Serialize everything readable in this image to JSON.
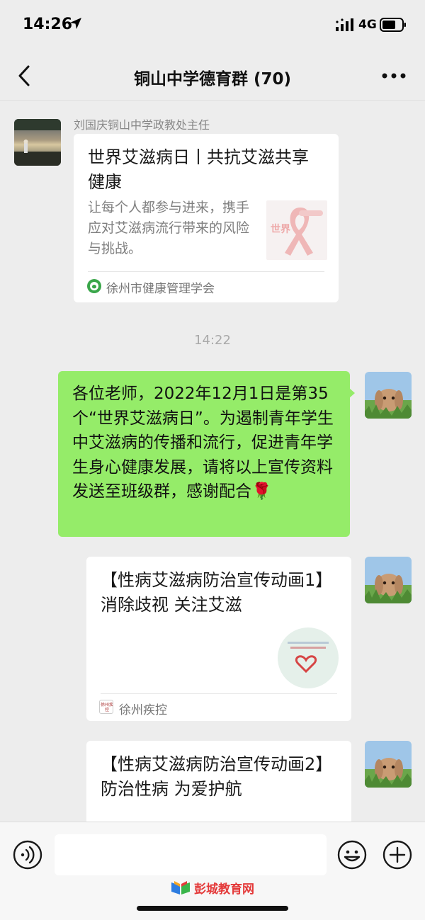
{
  "status_bar": {
    "time": "14:26",
    "network": "4G"
  },
  "header": {
    "title": "铜山中学德育群 (70)"
  },
  "messages": {
    "sender_name": "刘国庆铜山中学政教处主任",
    "card1": {
      "title": "世界艾滋病日丨共抗艾滋共享健康",
      "description": "让每个人都参与进来，携手应对艾滋病流行带来的风险与挑战。",
      "source": "徐州市健康管理学会",
      "thumb_text": "世界"
    },
    "timestamp": "14:22",
    "text_message": "各位老师，2022年12月1日是第35个“世界艾滋病日”。为遏制青年学生中艾滋病的传播和流行，促进青年学生身心健康发展，请将以上宣传资料发送至班级群，感谢配合🌹",
    "card2": {
      "title": "【性病艾滋病防治宣传动画1】消除歧视 关注艾滋",
      "source": "徐州疾控",
      "source_logo_text": "徐州疾控"
    },
    "card3": {
      "title": "【性病艾滋病防治宣传动画2】防治性病 为爱护航"
    }
  },
  "input_bar": {
    "placeholder": ""
  },
  "watermark": {
    "text": "彭城教育网"
  },
  "colors": {
    "bubble_green": "#95ec69",
    "background": "#ededed",
    "ribbon_red": "#e05a5a"
  }
}
